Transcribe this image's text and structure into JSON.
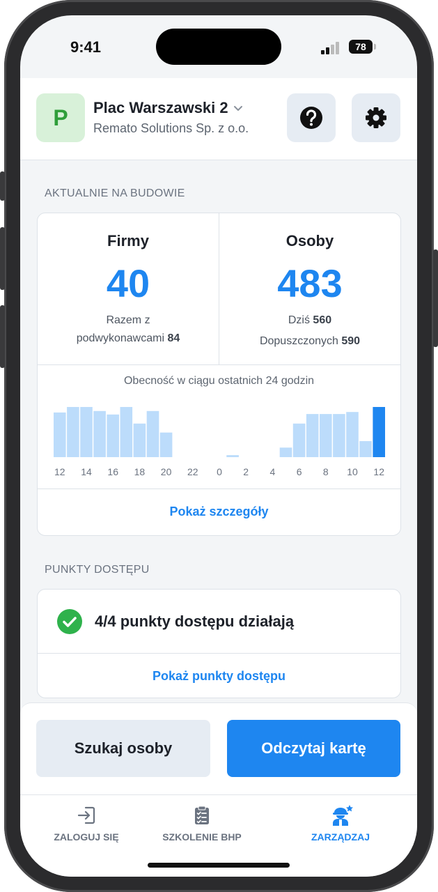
{
  "status": {
    "time": "9:41",
    "battery": "78"
  },
  "header": {
    "avatar_letter": "P",
    "site_name": "Plac Warszawski 2",
    "company": "Remato Solutions Sp. z o.o.",
    "help_icon": "question-icon",
    "settings_icon": "gear-icon"
  },
  "on_site": {
    "section_label": "AKTUALNIE NA BUDOWIE",
    "companies": {
      "title": "Firmy",
      "value": "40",
      "sub_line1": "Razem z",
      "sub_line2_text": "podwykonawcami ",
      "sub_line2_value": "84"
    },
    "people": {
      "title": "Osoby",
      "value": "483",
      "today_text": "Dziś ",
      "today_value": "560",
      "admitted_text": "Dopuszczonych ",
      "admitted_value": "590"
    },
    "chart_title": "Obecność w ciągu ostatnich 24 godzin",
    "details_link": "Pokaż szczegóły"
  },
  "chart_data": {
    "type": "bar",
    "title": "Obecność w ciągu ostatnich 24 godzin",
    "x_tick_labels": [
      "12",
      "14",
      "16",
      "18",
      "20",
      "22",
      "0",
      "2",
      "4",
      "6",
      "8",
      "10",
      "12"
    ],
    "hours": [
      "12",
      "13",
      "14",
      "15",
      "16",
      "17",
      "18",
      "19",
      "20",
      "21",
      "22",
      "23",
      "0",
      "1",
      "2",
      "3",
      "4",
      "5",
      "6",
      "7",
      "8",
      "9",
      "10",
      "11",
      "12"
    ],
    "values": [
      0.89,
      1.0,
      1.0,
      0.92,
      0.85,
      1.0,
      0.67,
      0.92,
      0.49,
      0,
      0,
      0,
      0,
      0.04,
      0,
      0,
      0,
      0.19,
      0.67,
      0.86,
      0.86,
      0.86,
      0.9,
      0.32,
      1.0
    ],
    "value_scale": "relative (no y axis shown)",
    "highlight_last": true,
    "colors": {
      "bar": "#bcdcfb",
      "highlight": "#1e86f0"
    }
  },
  "access_points": {
    "section_label": "PUNKTY DOSTĘPU",
    "status_text": "4/4 punkty dostępu działają",
    "status_icon": "check-circle-icon",
    "link": "Pokaż punkty dostępu"
  },
  "actions": {
    "search_person": "Szukaj osoby",
    "read_card": "Odczytaj kartę"
  },
  "tabs": [
    {
      "label": "ZALOGUJ SIĘ",
      "icon": "login-icon",
      "active": false
    },
    {
      "label": "SZKOLENIE BHP",
      "icon": "clipboard-checklist-icon",
      "active": false
    },
    {
      "label": "ZARZĄDZAJ",
      "icon": "worker-star-icon",
      "active": true
    }
  ],
  "colors": {
    "accent": "#1e86f0",
    "success": "#2fb24c",
    "avatar_bg": "#d8f1d9"
  }
}
